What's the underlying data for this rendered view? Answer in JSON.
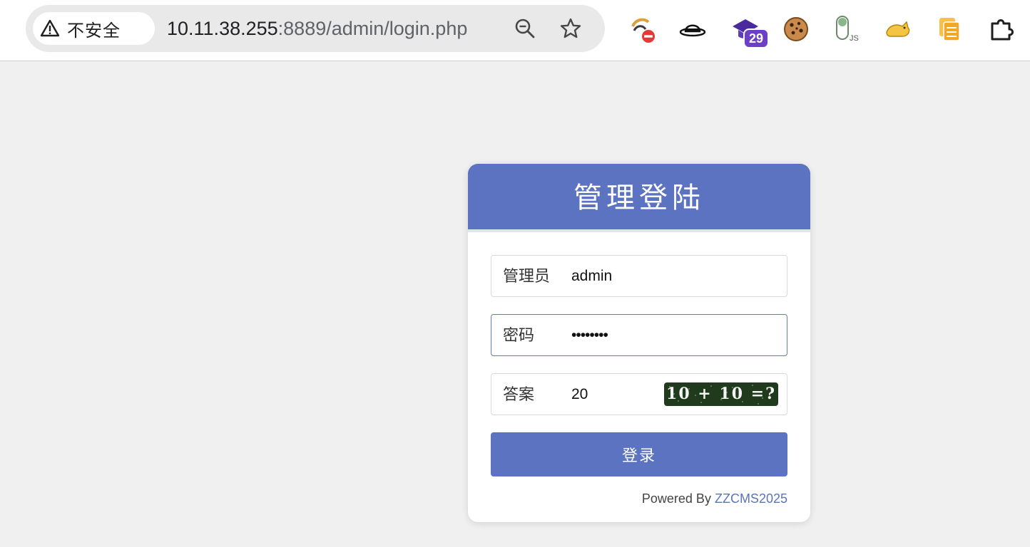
{
  "browser": {
    "security_label": "不安全",
    "url_host": "10.11.38.255",
    "url_rest": ":8889/admin/login.php",
    "extensions": [
      {
        "name": "adblock-extension"
      },
      {
        "name": "spy-hat-extension"
      },
      {
        "name": "graduation-cap-extension",
        "badge": "29"
      },
      {
        "name": "cookie-extension"
      },
      {
        "name": "javascript-toggle-extension",
        "label": "JS"
      },
      {
        "name": "tomcat-extension"
      },
      {
        "name": "copy-pages-extension"
      },
      {
        "name": "puzzle-extensions-menu"
      }
    ]
  },
  "login": {
    "title": "管理登陆",
    "username_label": "管理员",
    "username_value": "admin",
    "password_label": "密码",
    "password_value": "••••••••",
    "answer_label": "答案",
    "answer_value": "20",
    "captcha_text": "10 + 10 =?",
    "submit_label": "登录",
    "powered_by": "Powered By ",
    "powered_link": "ZZCMS2025"
  },
  "colors": {
    "accent": "#5b73c1",
    "page_bg": "#f0f0f0",
    "captcha_bg": "#1f3a1c",
    "badge": "#6c3fc4"
  }
}
